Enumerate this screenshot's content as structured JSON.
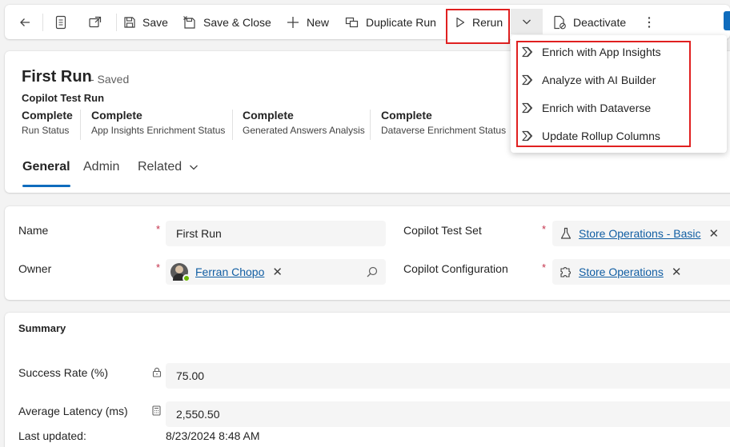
{
  "colors": {
    "accent": "#0f6cbd",
    "link": "#115ea3",
    "highlight_box": "#e02020",
    "required": "#c4314b",
    "presence_available": "#6bb700"
  },
  "toolbar": {
    "back_icon": "arrow-left-icon",
    "form_icon": "document-icon",
    "popout_icon": "open-new-window-icon",
    "save_label": "Save",
    "save_close_label": "Save & Close",
    "new_label": "New",
    "duplicate_label": "Duplicate Run",
    "rerun_label": "Rerun",
    "deactivate_label": "Deactivate",
    "more_icon": "more-vertical-icon"
  },
  "rerun_menu": {
    "items": [
      {
        "label": "Enrich with App Insights",
        "icon": "flow-icon"
      },
      {
        "label": "Analyze with AI Builder",
        "icon": "flow-icon"
      },
      {
        "label": "Enrich with Dataverse",
        "icon": "flow-icon"
      },
      {
        "label": "Update Rollup Columns",
        "icon": "flow-icon"
      }
    ]
  },
  "header": {
    "title": "First Run",
    "saved_state": "- Saved",
    "entity": "Copilot Test Run",
    "statuses": [
      {
        "value": "Complete",
        "label": "Run Status"
      },
      {
        "value": "Complete",
        "label": "App Insights Enrichment Status"
      },
      {
        "value": "Complete",
        "label": "Generated Answers Analysis"
      },
      {
        "value": "Complete",
        "label": "Dataverse Enrichment Status"
      }
    ],
    "tabs": [
      {
        "label": "General",
        "active": true
      },
      {
        "label": "Admin",
        "active": false
      },
      {
        "label": "Related",
        "active": false
      }
    ]
  },
  "fields": {
    "required_mark": "*",
    "name": {
      "label": "Name",
      "value": "First Run"
    },
    "owner": {
      "label": "Owner",
      "value": "Ferran Chopo"
    },
    "test_set": {
      "label": "Copilot Test Set",
      "value": "Store Operations - Basic"
    },
    "configuration": {
      "label": "Copilot Configuration",
      "value": "Store Operations"
    }
  },
  "summary": {
    "title": "Summary",
    "success_rate": {
      "label": "Success Rate (%)",
      "value": "75.00"
    },
    "avg_latency": {
      "label": "Average Latency (ms)",
      "value": "2,550.50"
    },
    "last_updated": {
      "label": "Last updated:",
      "value": "8/23/2024 8:48 AM"
    }
  }
}
